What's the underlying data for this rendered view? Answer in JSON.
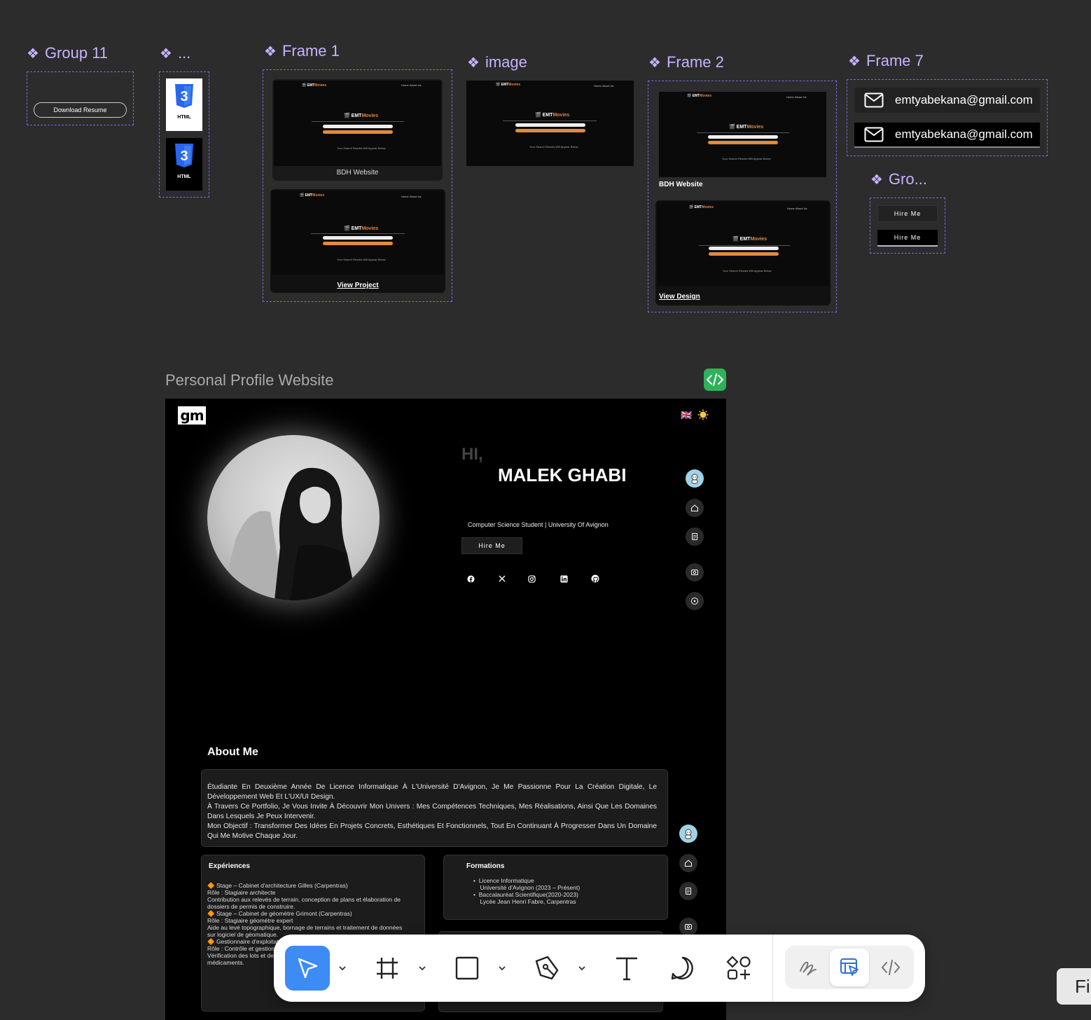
{
  "components": {
    "group11": {
      "label": "Group 11",
      "button": "Download Resume"
    },
    "dots": {
      "label": "...",
      "badges": [
        "HTML",
        "HTML"
      ]
    },
    "frame1": {
      "label": "Frame 1",
      "card1_caption": "BDH Website",
      "card2_caption": "View Project"
    },
    "image": {
      "label": "image"
    },
    "frame2": {
      "label": "Frame 2",
      "card1_caption": "BDH Website",
      "card2_caption": "View Design"
    },
    "frame7": {
      "label": "Frame 7",
      "emails": [
        "emtyabekana@gmail.com",
        "emtyabekana@gmail.com"
      ]
    },
    "gro": {
      "label": "Gro...",
      "buttons": [
        "Hire Me",
        "Hire Me"
      ]
    }
  },
  "thumb": {
    "brand_prefix": "🎬 EMT",
    "brand_suffix": "Movies",
    "nav": [
      "Home",
      "About Us"
    ],
    "results": "Your Search Results Will Appear Below"
  },
  "frame_title": "Personal Profile Website",
  "site": {
    "logo": "gm",
    "flag": "🇬🇧",
    "hi": "HI,",
    "name": "MALEK GHABI",
    "subtitle": "Computer Science Student | University Of Avignon",
    "hire_button": "Hire Me",
    "socials": [
      "facebook-icon",
      "x-icon",
      "instagram-icon",
      "linkedin-icon",
      "github-icon"
    ],
    "about_title": "About Me",
    "about_text": "Étudiante En Deuxième Année De Licence Informatique À L'Université D'Avignon, Je Me Passionne Pour La Création Digitale, Le Développement Web Et L'UX/UI Design.\nÀ Travers Ce Portfolio, Je Vous Invite À Découvrir Mon Univers : Mes Compétences Techniques, Mes Réalisations, Ainsi Que Les Domaines Dans Lesquels Je Peux Intervenir.\nMon Objectif : Transformer Des Idées En Projets Concrets, Esthétiques Et Fonctionnels, Tout En Continuant À Progresser Dans Un Domaine Qui Me Motive Chaque Jour.",
    "experiences_title": "Expériences",
    "experiences_text": "🔶 Stage – Cabinet d'architecture Gilles (Carpentras)\nRôle : Stagiaire architecte\nContribution aux relevés de terrain, conception de plans et élaboration de\ndossiers de permis de construire.\n🔶 Stage – Cabinet de géomètre Grimont (Carpentras)\nRôle : Stagiaire géomètre expert\nAide au levé topographique, bornage de terrains et traitement de données\nsur logiciel de géomatique.\n🔶 Gestionnaire d'exploitat\nRôle : Contrôle et gestion\nVérification des lots et de\nmédicaments.",
    "formations_title": "Formations",
    "formations_text": "•  Licence Informatique\n    Université d'Avignon (2023 – Présent)\n•  Baccalauréat Scientifique(2020-2023)\n    Lycée Jean Henri Fabre, Carpentras"
  },
  "toolbar": {
    "tools": [
      "move-tool",
      "frame-tool",
      "rectangle-tool",
      "pen-tool",
      "text-tool",
      "comment-tool",
      "actions-tool"
    ],
    "modes": [
      "draw-mode",
      "design-mode",
      "dev-mode"
    ]
  },
  "corner_button": "Fi"
}
